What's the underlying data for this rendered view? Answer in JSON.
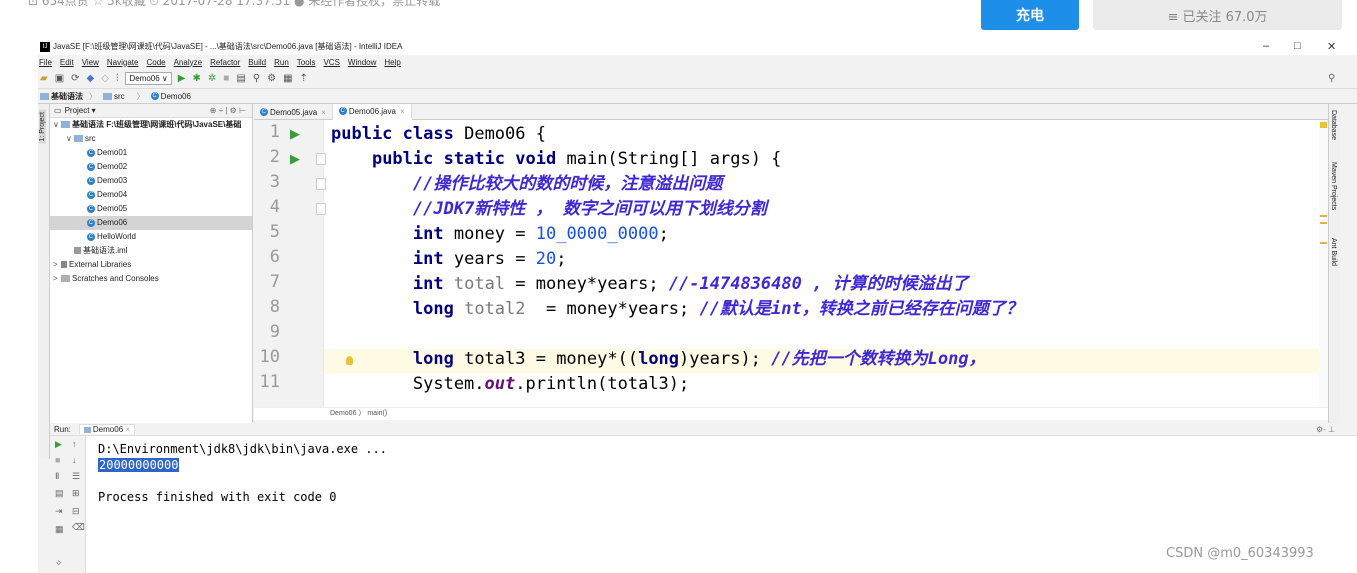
{
  "blog": {
    "meta_text": "⊡ 654点赞  ☆ 5k收藏  ⏲ 2017-07-28 17:37:51  ● 未经作者授权，禁止转载",
    "charge_label": "充电",
    "follow_label": "≡ 已关注 67.0万"
  },
  "window": {
    "title": "JavaSE [F:\\班级管理\\网课班\\代码\\JavaSE] - ...\\基础语法\\src\\Demo06.java [基础语法] - IntelliJ IDEA",
    "app_icon": "IJ",
    "controls": {
      "minimize": "–",
      "maximize": "□",
      "close": "✕"
    }
  },
  "menu": [
    "File",
    "Edit",
    "View",
    "Navigate",
    "Code",
    "Analyze",
    "Refactor",
    "Build",
    "Run",
    "Tools",
    "VCS",
    "Window",
    "Help"
  ],
  "toolbar": {
    "run_config": "Demo06 ∨"
  },
  "breadcrumb": {
    "project": "基础语法",
    "folder": "src",
    "file": "Demo06"
  },
  "left_stripe": {
    "label": "1: Project"
  },
  "project_panel": {
    "title": "Project ▾",
    "tree": [
      {
        "label": "基础语法  F:\\班级管理\\网课班\\代码\\JavaSE\\基础",
        "depth": 0,
        "arrow": "∨",
        "type": "module"
      },
      {
        "label": "src",
        "depth": 1,
        "arrow": "∨",
        "type": "folder"
      },
      {
        "label": "Demo01",
        "depth": 2,
        "arrow": "",
        "type": "class"
      },
      {
        "label": "Demo02",
        "depth": 2,
        "arrow": "",
        "type": "class"
      },
      {
        "label": "Demo03",
        "depth": 2,
        "arrow": "",
        "type": "class"
      },
      {
        "label": "Demo04",
        "depth": 2,
        "arrow": "",
        "type": "class"
      },
      {
        "label": "Demo05",
        "depth": 2,
        "arrow": "",
        "type": "class"
      },
      {
        "label": "Demo06",
        "depth": 2,
        "arrow": "",
        "type": "class",
        "selected": true
      },
      {
        "label": "HelloWorld",
        "depth": 2,
        "arrow": "",
        "type": "class"
      },
      {
        "label": "基础语法.iml",
        "depth": 1,
        "arrow": "",
        "type": "file"
      },
      {
        "label": "External Libraries",
        "depth": 0,
        "arrow": ">",
        "type": "lib"
      },
      {
        "label": "Scratches and Consoles",
        "depth": 0,
        "arrow": ">",
        "type": "scratch"
      }
    ]
  },
  "tabs": [
    {
      "label": "Demo05.java",
      "active": false
    },
    {
      "label": "Demo06.java",
      "active": true
    }
  ],
  "editor": {
    "line_numbers": [
      "1",
      "2",
      "3",
      "4",
      "5",
      "6",
      "7",
      "8",
      "9",
      "10",
      "11"
    ],
    "lines": [
      "public class Demo06 {",
      "    public static void main(String[] args) {",
      "        //操作比较大的数的时候，注意溢出问题",
      "        //JDK7新特性 ， 数字之间可以用下划线分割",
      "        int money = 10_0000_0000;",
      "        int years = 20;",
      "        int total = money*years; //-1474836480 , 计算的时候溢出了",
      "        long total2  = money*years; //默认是int，转换之前已经存在问题了？",
      "",
      "        long total3 = money*((long)years); //先把一个数转换为Long，",
      "        System.out.println(total3);"
    ],
    "breadcrumbs": "Demo06 〉 main()"
  },
  "right_stripe": [
    "Database",
    "Maven Projects",
    "Ant Build"
  ],
  "run_panel": {
    "label": "Run:",
    "tab": "Demo06",
    "console_lines": [
      "D:\\Environment\\jdk8\\jdk\\bin\\java.exe ...",
      "20000000000",
      "",
      "Process finished with exit code 0"
    ]
  },
  "watermark": "CSDN @m0_60343993"
}
